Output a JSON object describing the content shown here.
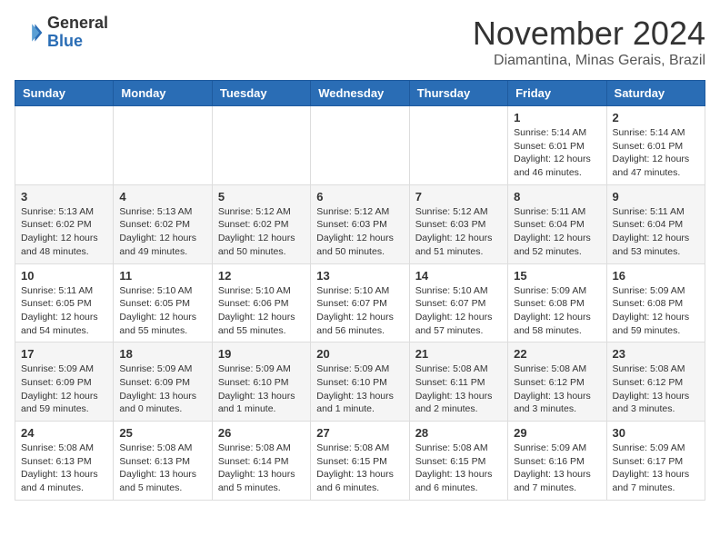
{
  "header": {
    "logo_general": "General",
    "logo_blue": "Blue",
    "month_title": "November 2024",
    "location": "Diamantina, Minas Gerais, Brazil"
  },
  "weekdays": [
    "Sunday",
    "Monday",
    "Tuesday",
    "Wednesday",
    "Thursday",
    "Friday",
    "Saturday"
  ],
  "weeks": [
    [
      {
        "day": "",
        "info": ""
      },
      {
        "day": "",
        "info": ""
      },
      {
        "day": "",
        "info": ""
      },
      {
        "day": "",
        "info": ""
      },
      {
        "day": "",
        "info": ""
      },
      {
        "day": "1",
        "info": "Sunrise: 5:14 AM\nSunset: 6:01 PM\nDaylight: 12 hours and 46 minutes."
      },
      {
        "day": "2",
        "info": "Sunrise: 5:14 AM\nSunset: 6:01 PM\nDaylight: 12 hours and 47 minutes."
      }
    ],
    [
      {
        "day": "3",
        "info": "Sunrise: 5:13 AM\nSunset: 6:02 PM\nDaylight: 12 hours and 48 minutes."
      },
      {
        "day": "4",
        "info": "Sunrise: 5:13 AM\nSunset: 6:02 PM\nDaylight: 12 hours and 49 minutes."
      },
      {
        "day": "5",
        "info": "Sunrise: 5:12 AM\nSunset: 6:02 PM\nDaylight: 12 hours and 50 minutes."
      },
      {
        "day": "6",
        "info": "Sunrise: 5:12 AM\nSunset: 6:03 PM\nDaylight: 12 hours and 50 minutes."
      },
      {
        "day": "7",
        "info": "Sunrise: 5:12 AM\nSunset: 6:03 PM\nDaylight: 12 hours and 51 minutes."
      },
      {
        "day": "8",
        "info": "Sunrise: 5:11 AM\nSunset: 6:04 PM\nDaylight: 12 hours and 52 minutes."
      },
      {
        "day": "9",
        "info": "Sunrise: 5:11 AM\nSunset: 6:04 PM\nDaylight: 12 hours and 53 minutes."
      }
    ],
    [
      {
        "day": "10",
        "info": "Sunrise: 5:11 AM\nSunset: 6:05 PM\nDaylight: 12 hours and 54 minutes."
      },
      {
        "day": "11",
        "info": "Sunrise: 5:10 AM\nSunset: 6:05 PM\nDaylight: 12 hours and 55 minutes."
      },
      {
        "day": "12",
        "info": "Sunrise: 5:10 AM\nSunset: 6:06 PM\nDaylight: 12 hours and 55 minutes."
      },
      {
        "day": "13",
        "info": "Sunrise: 5:10 AM\nSunset: 6:07 PM\nDaylight: 12 hours and 56 minutes."
      },
      {
        "day": "14",
        "info": "Sunrise: 5:10 AM\nSunset: 6:07 PM\nDaylight: 12 hours and 57 minutes."
      },
      {
        "day": "15",
        "info": "Sunrise: 5:09 AM\nSunset: 6:08 PM\nDaylight: 12 hours and 58 minutes."
      },
      {
        "day": "16",
        "info": "Sunrise: 5:09 AM\nSunset: 6:08 PM\nDaylight: 12 hours and 59 minutes."
      }
    ],
    [
      {
        "day": "17",
        "info": "Sunrise: 5:09 AM\nSunset: 6:09 PM\nDaylight: 12 hours and 59 minutes."
      },
      {
        "day": "18",
        "info": "Sunrise: 5:09 AM\nSunset: 6:09 PM\nDaylight: 13 hours and 0 minutes."
      },
      {
        "day": "19",
        "info": "Sunrise: 5:09 AM\nSunset: 6:10 PM\nDaylight: 13 hours and 1 minute."
      },
      {
        "day": "20",
        "info": "Sunrise: 5:09 AM\nSunset: 6:10 PM\nDaylight: 13 hours and 1 minute."
      },
      {
        "day": "21",
        "info": "Sunrise: 5:08 AM\nSunset: 6:11 PM\nDaylight: 13 hours and 2 minutes."
      },
      {
        "day": "22",
        "info": "Sunrise: 5:08 AM\nSunset: 6:12 PM\nDaylight: 13 hours and 3 minutes."
      },
      {
        "day": "23",
        "info": "Sunrise: 5:08 AM\nSunset: 6:12 PM\nDaylight: 13 hours and 3 minutes."
      }
    ],
    [
      {
        "day": "24",
        "info": "Sunrise: 5:08 AM\nSunset: 6:13 PM\nDaylight: 13 hours and 4 minutes."
      },
      {
        "day": "25",
        "info": "Sunrise: 5:08 AM\nSunset: 6:13 PM\nDaylight: 13 hours and 5 minutes."
      },
      {
        "day": "26",
        "info": "Sunrise: 5:08 AM\nSunset: 6:14 PM\nDaylight: 13 hours and 5 minutes."
      },
      {
        "day": "27",
        "info": "Sunrise: 5:08 AM\nSunset: 6:15 PM\nDaylight: 13 hours and 6 minutes."
      },
      {
        "day": "28",
        "info": "Sunrise: 5:08 AM\nSunset: 6:15 PM\nDaylight: 13 hours and 6 minutes."
      },
      {
        "day": "29",
        "info": "Sunrise: 5:09 AM\nSunset: 6:16 PM\nDaylight: 13 hours and 7 minutes."
      },
      {
        "day": "30",
        "info": "Sunrise: 5:09 AM\nSunset: 6:17 PM\nDaylight: 13 hours and 7 minutes."
      }
    ]
  ]
}
